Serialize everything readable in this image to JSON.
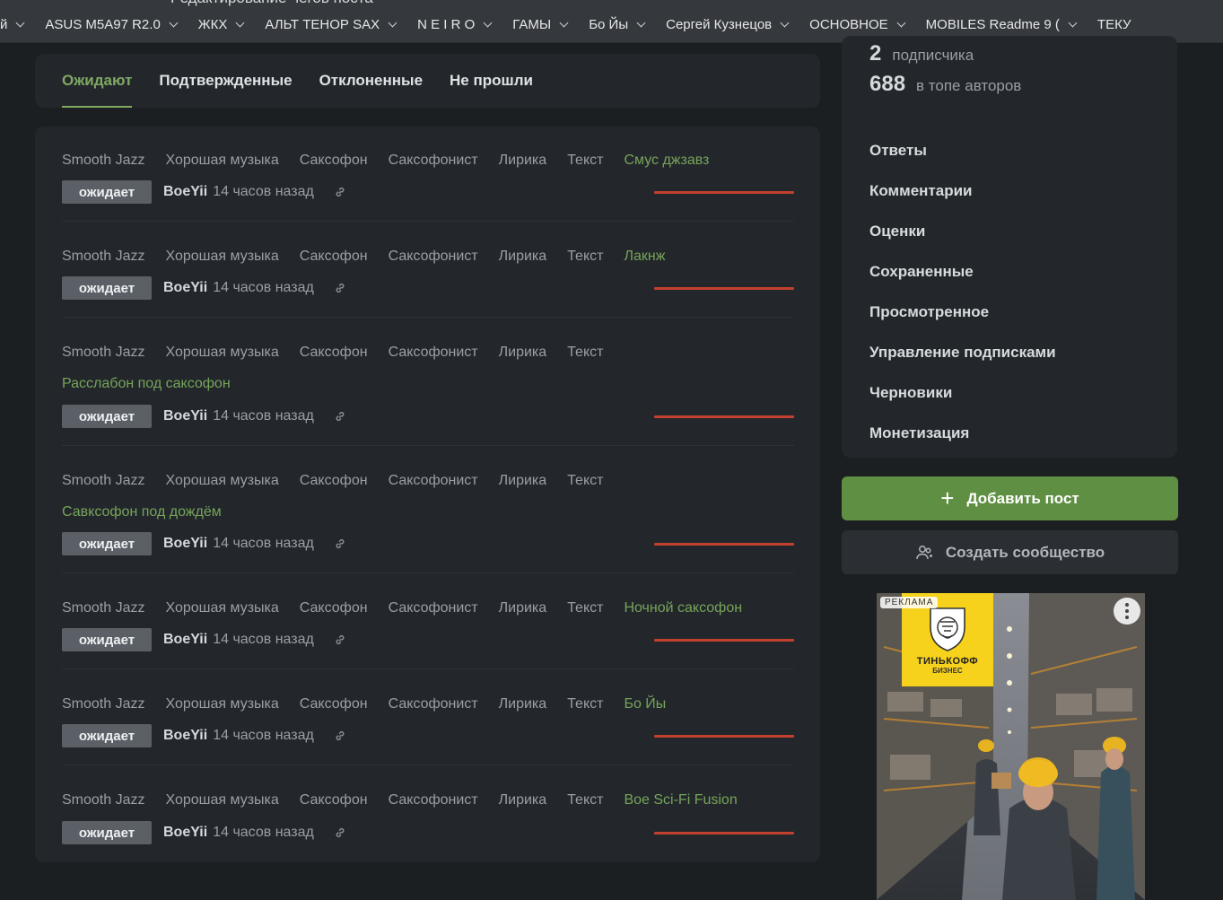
{
  "window": {
    "title_fragment": "Редактирование чегов поста"
  },
  "bookmarks": [
    {
      "label": "й"
    },
    {
      "label": "ASUS M5A97 R2.0"
    },
    {
      "label": "ЖКХ"
    },
    {
      "label": "АЛЬТ ТЕНОР SAX"
    },
    {
      "label": "N E I R O"
    },
    {
      "label": "ГАМЫ"
    },
    {
      "label": "Бо Йы"
    },
    {
      "label": "Сергей Кузнецов"
    },
    {
      "label": "ОСНОВНОЕ"
    },
    {
      "label": "MOBILES Readme 9 ("
    },
    {
      "label": "ТЕКУ"
    }
  ],
  "tabs": [
    {
      "label": "Ожидают",
      "active": true
    },
    {
      "label": "Подтвержденные",
      "active": false
    },
    {
      "label": "Отклоненные",
      "active": false
    },
    {
      "label": "Не прошли",
      "active": false
    }
  ],
  "common_tags": [
    "Smooth Jazz",
    "Хорошая музыка",
    "Саксофон",
    "Саксофонист",
    "Лирика",
    "Текст"
  ],
  "posts": [
    {
      "tags": [
        "Smooth Jazz",
        "Хорошая музыка",
        "Саксофон",
        "Саксофонист",
        "Лирика",
        "Текст"
      ],
      "title": "Смус джзавз",
      "status": "ожидает",
      "author": "BoeYii",
      "time": "14 часов назад"
    },
    {
      "tags": [
        "Smooth Jazz",
        "Хорошая музыка",
        "Саксофон",
        "Саксофонист",
        "Лирика",
        "Текст"
      ],
      "title": "Лакнж",
      "status": "ожидает",
      "author": "BoeYii",
      "time": "14 часов назад"
    },
    {
      "tags": [
        "Smooth Jazz",
        "Хорошая музыка",
        "Саксофон",
        "Саксофонист",
        "Лирика",
        "Текст"
      ],
      "title": "Расслабон под саксофон",
      "status": "ожидает",
      "author": "BoeYii",
      "time": "14 часов назад"
    },
    {
      "tags": [
        "Smooth Jazz",
        "Хорошая музыка",
        "Саксофон",
        "Саксофонист",
        "Лирика",
        "Текст"
      ],
      "title": "Савксофон под дождём",
      "status": "ожидает",
      "author": "BoeYii",
      "time": "14 часов назад"
    },
    {
      "tags": [
        "Smooth Jazz",
        "Хорошая музыка",
        "Саксофон",
        "Саксофонист",
        "Лирика",
        "Текст"
      ],
      "title": "Ночной саксофон",
      "status": "ожидает",
      "author": "BoeYii",
      "time": "14 часов назад"
    },
    {
      "tags": [
        "Smooth Jazz",
        "Хорошая музыка",
        "Саксофон",
        "Саксофонист",
        "Лирика",
        "Текст"
      ],
      "title": "Бо Йы",
      "status": "ожидает",
      "author": "BoeYii",
      "time": "14 часов назад"
    },
    {
      "tags": [
        "Smooth Jazz",
        "Хорошая музыка",
        "Саксофон",
        "Саксофонист",
        "Лирика",
        "Текст"
      ],
      "title": "Boe Sci-Fi Fusion",
      "status": "ожидает",
      "author": "BoeYii",
      "time": "14 часов назад"
    }
  ],
  "sidebar": {
    "stats": [
      {
        "value": "2",
        "label": "подписчика"
      },
      {
        "value": "688",
        "label": "в топе авторов"
      }
    ],
    "menu": [
      "Ответы",
      "Комментарии",
      "Оценки",
      "Сохраненные",
      "Просмотренное",
      "Управление подписками",
      "Черновики",
      "Монетизация"
    ],
    "add_post_label": "Добавить пост",
    "create_community_label": "Создать сообщество"
  },
  "ad": {
    "label": "РЕКЛАМА",
    "brand_line1": "ТИНЬКОФФ",
    "brand_line2": "БИЗНЕС"
  },
  "colors": {
    "accent_green": "#7fa862",
    "button_green": "#5f8f42",
    "red_line": "#c2402e",
    "card_bg": "#23272b",
    "page_bg": "#1c1f22"
  },
  "icons": [
    "chevron-down-icon",
    "link-icon",
    "plus-icon",
    "community-icon",
    "more-vertical-icon"
  ]
}
